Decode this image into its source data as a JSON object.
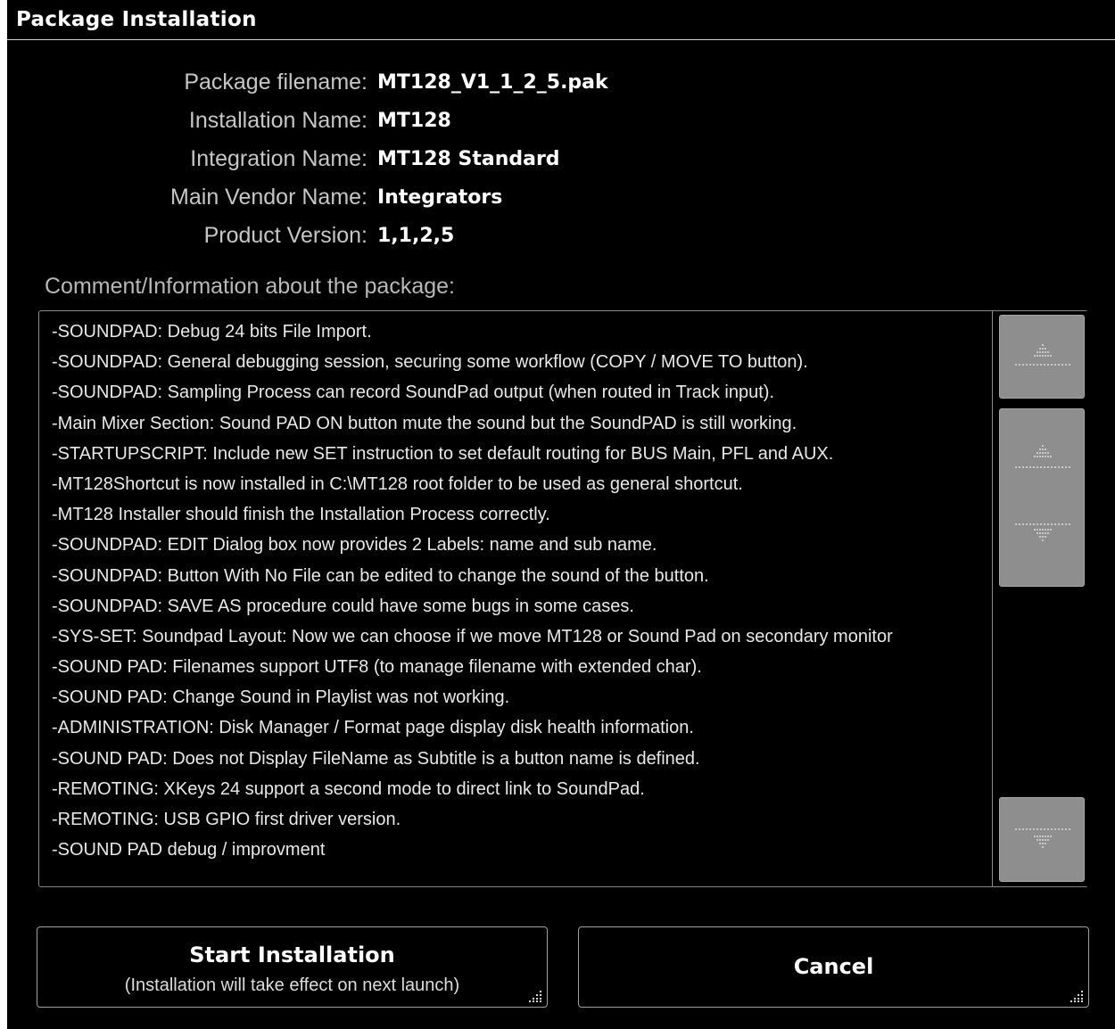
{
  "window": {
    "title": "Package Installation"
  },
  "package_info": [
    {
      "label": "Package filename:",
      "value": "MT128_V1_1_2_5.pak"
    },
    {
      "label": "Installation Name:",
      "value": "MT128"
    },
    {
      "label": "Integration Name:",
      "value": "MT128 Standard"
    },
    {
      "label": "Main Vendor Name:",
      "value": "Integrators"
    },
    {
      "label": "Product Version:",
      "value": "1,1,2,5"
    }
  ],
  "comments": {
    "heading": "Comment/Information about the package:",
    "lines": [
      "-SOUNDPAD: Debug 24 bits File Import.",
      "-SOUNDPAD: General debugging session, securing some workflow (COPY / MOVE TO button).",
      "-SOUNDPAD: Sampling Process can record SoundPad output (when routed in Track input).",
      "-Main Mixer Section: Sound PAD ON button mute the sound but the SoundPAD is still working.",
      "-STARTUPSCRIPT: Include new SET instruction to set default routing for BUS Main, PFL and AUX.",
      "-MT128Shortcut is now installed in C:\\MT128 root folder to be used as general shortcut.",
      "-MT128 Installer should finish the Installation Process correctly.",
      "-SOUNDPAD: EDIT Dialog box now provides 2 Labels: name and sub name.",
      "-SOUNDPAD: Button With No File can be edited to change the sound of the button.",
      "-SOUNDPAD: SAVE AS procedure could have some bugs in some cases.",
      "-SYS-SET: Soundpad Layout: Now we can choose if we move MT128 or Sound Pad on secondary monitor",
      "-SOUND PAD: Filenames support UTF8 (to manage filename with extended char).",
      "-SOUND PAD: Change Sound in Playlist was not working.",
      "-ADMINISTRATION: Disk Manager / Format page display disk health information.",
      "-SOUND PAD: Does not Display FileName as Subtitle is a button name is defined.",
      "-REMOTING: XKeys 24 support a second mode to direct link to SoundPad.",
      "-REMOTING: USB GPIO first driver version.",
      "-SOUND PAD debug / improvment"
    ]
  },
  "scrollbar": {
    "buttons": [
      "scroll-top-icon",
      "scroll-up-icon",
      "scroll-down-icon",
      "scroll-bottom-icon"
    ]
  },
  "buttons": {
    "start_label": "Start Installation",
    "start_sublabel": "(Installation will take effect on next launch)",
    "cancel_label": "Cancel"
  },
  "colors": {
    "background": "#000000",
    "label_text": "#c6c6c6",
    "value_text": "#ffffff",
    "scroll_button": "#8e8e8e"
  }
}
